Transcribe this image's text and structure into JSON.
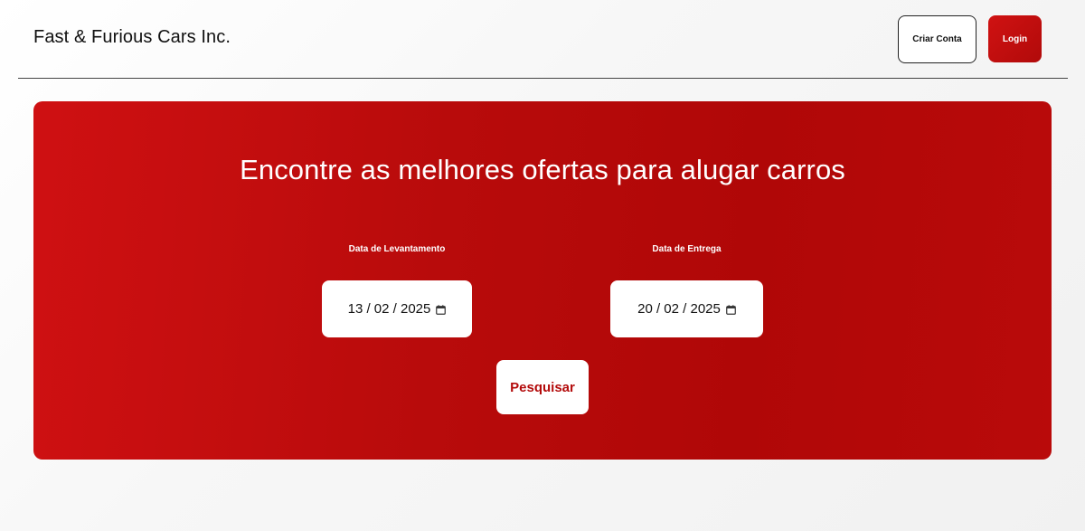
{
  "header": {
    "brand": "Fast & Furious Cars Inc.",
    "create_account_label": "Criar Conta",
    "login_label": "Login"
  },
  "hero": {
    "title": "Encontre as melhores ofertas para alugar carros",
    "pickup": {
      "label": "Data de Levantamento",
      "value": "13 / 02 / 2025",
      "icon": "calendar-icon"
    },
    "return": {
      "label": "Data de Entrega",
      "value": "20 / 02 / 2025",
      "icon": "calendar-icon"
    },
    "search_label": "Pesquisar"
  },
  "colors": {
    "brand_red": "#b80b0b",
    "brand_red_light": "#d01212",
    "background": "#f4f4f4",
    "text": "#111111"
  }
}
